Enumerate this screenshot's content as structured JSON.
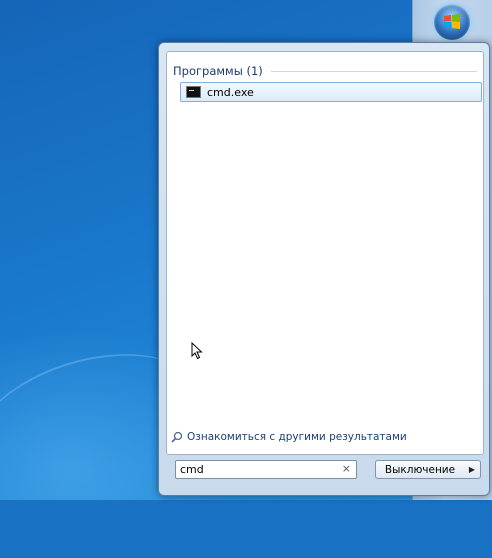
{
  "start_menu": {
    "group_title": "Программы (1)",
    "results": [
      {
        "label": "cmd.exe",
        "icon": "command-prompt-icon"
      }
    ],
    "more_results_label": "Ознакомиться с другими результатами",
    "search": {
      "value": "cmd",
      "clear_glyph": "×"
    },
    "shutdown_label": "Выключение",
    "shutdown_arrow_glyph": "▶"
  },
  "taskbar": {
    "start_button_icon": "windows-logo-icon"
  },
  "colors": {
    "accent": "#1e3a6e",
    "selection": "#dcecfc",
    "desktop": "#1a72c4"
  }
}
